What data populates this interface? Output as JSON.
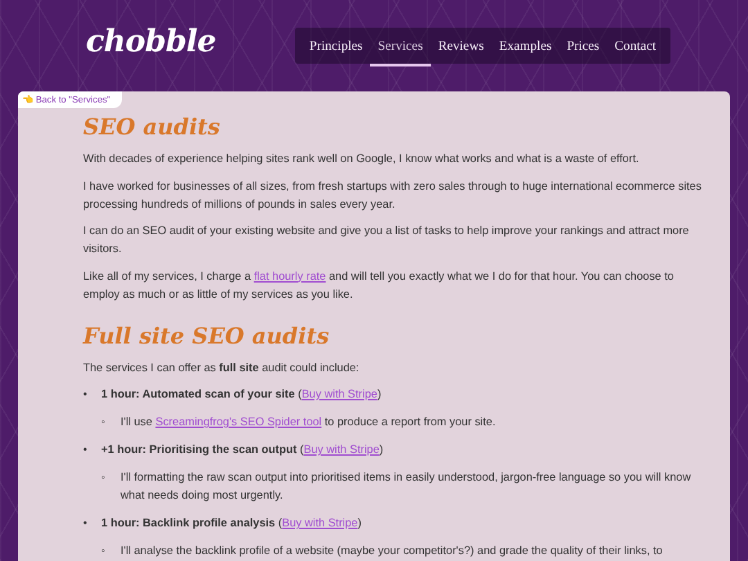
{
  "header": {
    "logo": "chobble"
  },
  "nav": [
    {
      "label": "Principles",
      "selected": false
    },
    {
      "label": "Services",
      "selected": true
    },
    {
      "label": "Reviews",
      "selected": false
    },
    {
      "label": "Examples",
      "selected": false
    },
    {
      "label": "Prices",
      "selected": false
    },
    {
      "label": "Contact",
      "selected": false
    }
  ],
  "back_link": {
    "icon": "👈",
    "label": "Back to \"Services\""
  },
  "content": [
    {
      "kind": "heading",
      "text": "SEO audits"
    },
    {
      "kind": "paragraph",
      "parts": [
        {
          "kind": "text",
          "text": "With decades of experience helping sites rank well on Google, I know what works and what is a waste of effort."
        }
      ]
    },
    {
      "kind": "paragraph",
      "parts": [
        {
          "kind": "text",
          "text": "I have worked for businesses of all sizes, from fresh startups with zero sales through to huge international ecommerce sites processing hundreds of millions of pounds in sales every year."
        }
      ]
    },
    {
      "kind": "paragraph",
      "parts": [
        {
          "kind": "text",
          "text": "I can do an SEO audit of your existing website and give you a list of tasks to help improve your rankings and attract more visitors."
        }
      ]
    },
    {
      "kind": "paragraph",
      "parts": [
        {
          "kind": "text",
          "text": "Like all of my services, I charge a "
        },
        {
          "kind": "link",
          "text": "flat hourly rate"
        },
        {
          "kind": "text",
          "text": " and will tell you exactly what we I do for that hour. You can choose to employ as much or as little of my services as you like."
        }
      ]
    },
    {
      "kind": "heading",
      "text": "Full site SEO audits"
    },
    {
      "kind": "paragraph",
      "parts": [
        {
          "kind": "text",
          "text": "The services I can offer as **full site** audit could include:"
        }
      ]
    },
    {
      "kind": "list",
      "items": [
        {
          "marker": "•",
          "parts": [
            {
              "kind": "bold",
              "text": "1 hour: Automated scan of your site"
            },
            {
              "kind": "text",
              "text": " ("
            },
            {
              "kind": "link",
              "text": "Buy with Stripe"
            },
            {
              "kind": "text",
              "text": ")"
            }
          ],
          "children": [
            {
              "marker": "◦",
              "parts": [
                {
                  "kind": "text",
                  "text": "I'll use "
                },
                {
                  "kind": "link",
                  "text": "Screamingfrog's SEO Spider tool"
                },
                {
                  "kind": "text",
                  "text": " to produce a report from your site."
                }
              ]
            }
          ]
        },
        {
          "marker": "•",
          "parts": [
            {
              "kind": "bold",
              "text": "+1 hour: Prioritising the scan output"
            },
            {
              "kind": "text",
              "text": " ("
            },
            {
              "kind": "link",
              "text": "Buy with Stripe"
            },
            {
              "kind": "text",
              "text": ")"
            }
          ],
          "children": [
            {
              "marker": "◦",
              "parts": [
                {
                  "kind": "text",
                  "text": "I'll formatting the raw scan output into prioritised items in easily understood, jargon-free language so you will know what needs doing most urgently."
                }
              ]
            }
          ]
        },
        {
          "marker": "•",
          "parts": [
            {
              "kind": "bold",
              "text": "1 hour: Backlink profile analysis"
            },
            {
              "kind": "text",
              "text": " ("
            },
            {
              "kind": "link",
              "text": "Buy with Stripe"
            },
            {
              "kind": "text",
              "text": ")"
            }
          ],
          "children": [
            {
              "marker": "◦",
              "parts": [
                {
                  "kind": "text",
                  "text": "I'll analyse the backlink profile of a website (maybe your competitor's?) and grade the quality of their links, to"
                }
              ]
            }
          ]
        }
      ]
    }
  ]
}
